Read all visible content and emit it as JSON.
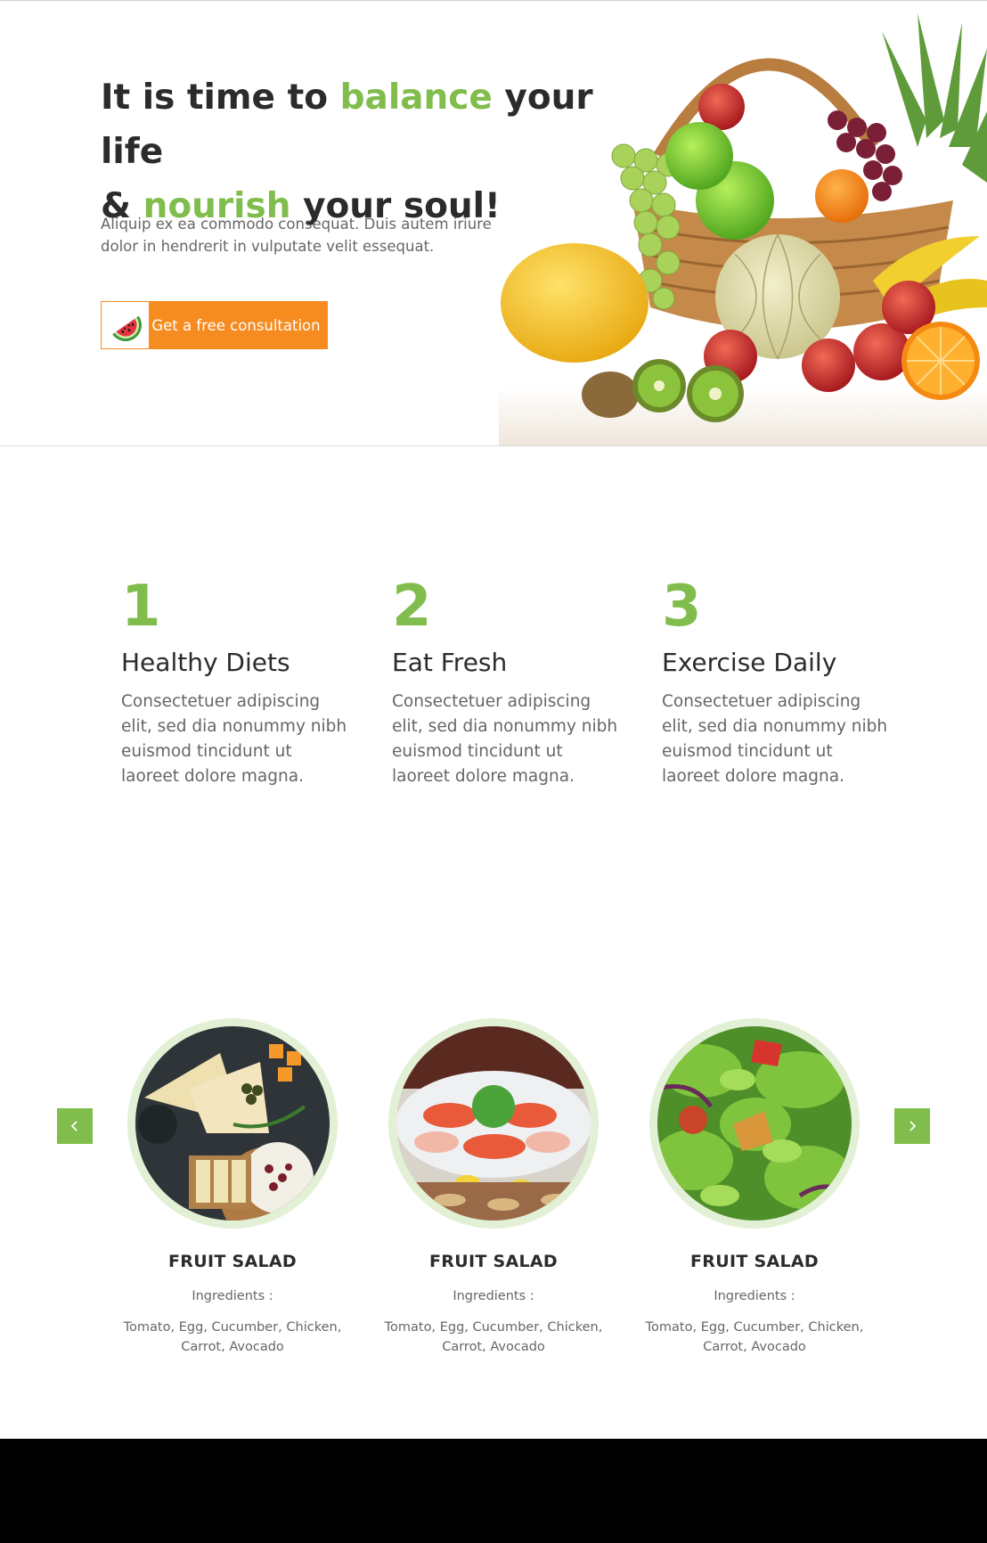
{
  "hero": {
    "title_part1": "It is time to ",
    "title_green1": "balance",
    "title_part2": " your life",
    "title_part3": "& ",
    "title_green2": "nourish",
    "title_part4": " your soul!",
    "description": "Aliquip ex ea commodo consequat. Duis autem iriure dolor in hendrerit in vulputate velit essequat.",
    "cta_label": "Get a free consultation",
    "cta_icon": "watermelon-icon"
  },
  "steps": [
    {
      "number": "1",
      "title": "Healthy Diets",
      "text": "Consectetuer adipiscing elit, sed dia nonummy nibh euismod tincidunt ut laoreet dolore magna."
    },
    {
      "number": "2",
      "title": "Eat Fresh",
      "text": "Consectetuer adipiscing elit, sed dia nonummy nibh euismod tincidunt ut laoreet dolore magna."
    },
    {
      "number": "3",
      "title": "Exercise Daily",
      "text": "Consectetuer adipiscing elit, sed dia nonummy nibh euismod tincidunt ut laoreet dolore magna."
    }
  ],
  "carousel": {
    "prev_icon": "chevron-left-icon",
    "next_icon": "chevron-right-icon",
    "cards": [
      {
        "title": "FRUIT SALAD",
        "ingredients_label": "Ingredients :",
        "ingredients": "Tomato, Egg, Cucumber, Chicken, Carrot, Avocado"
      },
      {
        "title": "FRUIT SALAD",
        "ingredients_label": "Ingredients :",
        "ingredients": "Tomato, Egg, Cucumber, Chicken, Carrot, Avocado"
      },
      {
        "title": "FRUIT SALAD",
        "ingredients_label": "Ingredients :",
        "ingredients": "Tomato, Egg, Cucumber, Chicken, Carrot, Avocado"
      }
    ]
  },
  "colors": {
    "accent_green": "#80bd4c",
    "cta_orange": "#f68b1f",
    "text_dark": "#2b2b2b",
    "text_muted": "#666666"
  }
}
